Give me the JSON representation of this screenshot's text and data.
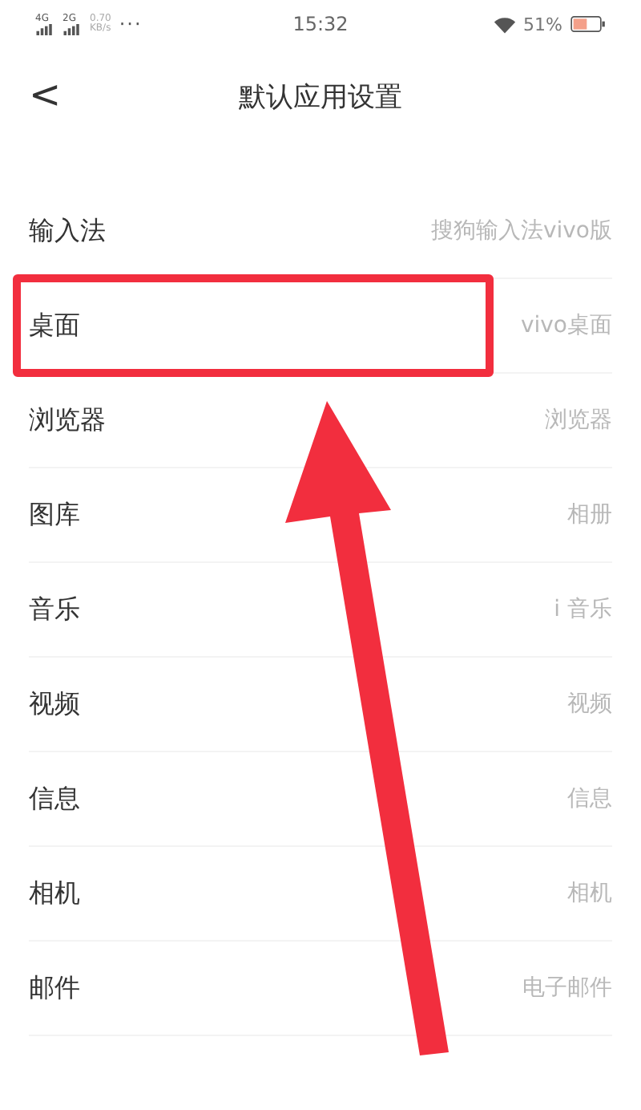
{
  "status_bar": {
    "network_1": "4G",
    "network_2": "2G",
    "speed": "0.70",
    "speed_unit": "KB/s",
    "more": "···",
    "time": "15:32",
    "battery": "51%"
  },
  "header": {
    "back": "<",
    "title": "默认应用设置"
  },
  "rows": [
    {
      "label": "输入法",
      "value": "搜狗输入法vivo版",
      "highlighted": false
    },
    {
      "label": "桌面",
      "value": "vivo桌面",
      "highlighted": true
    },
    {
      "label": "浏览器",
      "value": "浏览器",
      "highlighted": false
    },
    {
      "label": "图库",
      "value": "相册",
      "highlighted": false
    },
    {
      "label": "音乐",
      "value": "i 音乐",
      "highlighted": false
    },
    {
      "label": "视频",
      "value": "视频",
      "highlighted": false
    },
    {
      "label": "信息",
      "value": "信息",
      "highlighted": false
    },
    {
      "label": "相机",
      "value": "相机",
      "highlighted": false
    },
    {
      "label": "邮件",
      "value": "电子邮件",
      "highlighted": false
    }
  ]
}
